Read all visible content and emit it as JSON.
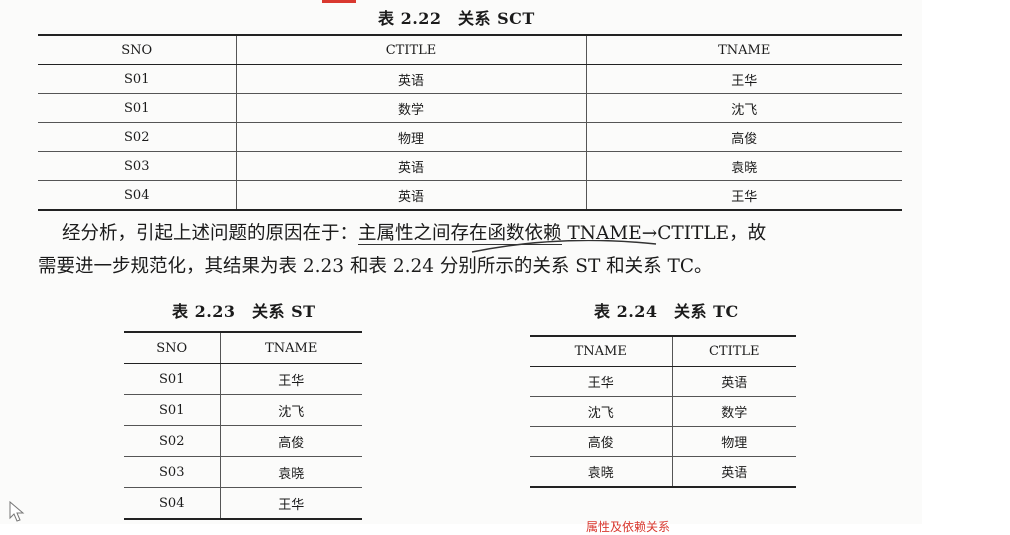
{
  "sct_table": {
    "caption": "表 2.22　关系 SCT",
    "headers": [
      "SNO",
      "CTITLE",
      "TNAME"
    ],
    "rows": [
      [
        "S01",
        "英语",
        "王华"
      ],
      [
        "S01",
        "数学",
        "沈飞"
      ],
      [
        "S02",
        "物理",
        "高俊"
      ],
      [
        "S03",
        "英语",
        "袁晓"
      ],
      [
        "S04",
        "英语",
        "王华"
      ]
    ]
  },
  "paragraph": {
    "line1_prefix": "经分析，引起上述问题的原因在于：",
    "line1_underlined": "主属性之间存在函数依赖",
    "line1_suffix": " TNAME→CTITLE，故",
    "line2": "需要进一步规范化，其结果为表 2.23 和表 2.24 分别所示的关系 ST 和关系 TC。"
  },
  "st_table": {
    "caption": "表 2.23　关系 ST",
    "headers": [
      "SNO",
      "TNAME"
    ],
    "rows": [
      [
        "S01",
        "王华"
      ],
      [
        "S01",
        "沈飞"
      ],
      [
        "S02",
        "高俊"
      ],
      [
        "S03",
        "袁晓"
      ],
      [
        "S04",
        "王华"
      ]
    ]
  },
  "tc_table": {
    "caption": "表 2.24　关系 TC",
    "headers": [
      "TNAME",
      "CTITLE"
    ],
    "rows": [
      [
        "王华",
        "英语"
      ],
      [
        "沈飞",
        "数学"
      ],
      [
        "高俊",
        "物理"
      ],
      [
        "袁晓",
        "英语"
      ]
    ]
  },
  "footer_note": "属性及依赖关系"
}
